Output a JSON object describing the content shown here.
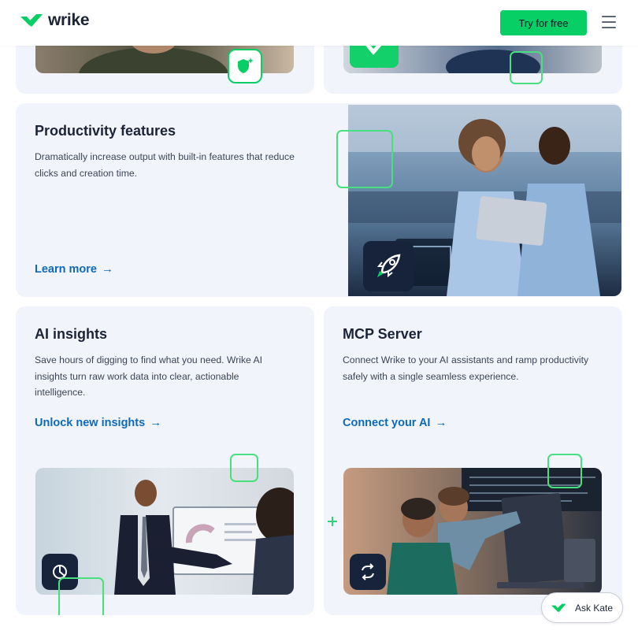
{
  "header": {
    "logo_text": "wrike",
    "cta_label": "Try for free",
    "menu_icon": "hamburger-menu-icon"
  },
  "cards": {
    "productivity": {
      "title": "Productivity features",
      "description": "Dramatically increase output with built-in features that reduce clicks and creation time.",
      "link_label": "Learn more",
      "icon": "rocket-icon"
    },
    "ai_insights": {
      "title": "AI insights",
      "description": "Save hours of digging to find what you need. Wrike AI insights turn raw work data into clear, actionable intelligence.",
      "link_label": "Unlock new insights",
      "icon": "pie-chart-icon"
    },
    "mcp": {
      "title": "MCP Server",
      "description": "Connect Wrike to your AI assistants and ramp productivity safely with a single seamless experience.",
      "link_label": "Connect your AI",
      "icon": "sync-arrows-icon"
    }
  },
  "arrow_glyph": "→",
  "ask_kate_label": "Ask Kate",
  "colors": {
    "brand_green": "#08cf65",
    "link_blue": "#0e6ab8",
    "card_bg": "#f1f4fb",
    "icon_badge_bg": "#17233b",
    "outline_green": "#48e07f"
  }
}
